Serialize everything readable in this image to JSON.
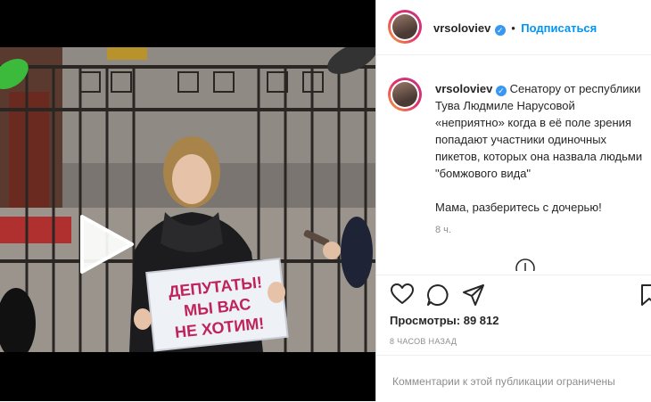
{
  "header": {
    "username": "vrsoloviev",
    "follow_label": "Подписаться",
    "verified_icon": "✓"
  },
  "post": {
    "username": "vrsoloviev",
    "caption_line1": "Сенатору от республики Тува Людмиле Нарусовой «неприятно» когда в её поле зрения попадают участники одиночных пикетов, которых она назвала людьми \"бомжового вида\"",
    "caption_line2": "Мама, разберитесь с дочерью!",
    "time": "8 ч."
  },
  "stats": {
    "views_label": "Просмотры:",
    "views_value": "89 812",
    "age": "8 ЧАСОВ НАЗАД"
  },
  "comments": {
    "notice": "Комментарии к этой публикации ограничены"
  },
  "video": {
    "sign_line1": "ДЕПУТАТЫ!",
    "sign_line2": "МЫ ВАС",
    "sign_line3": "НЕ ХОТИМ!"
  },
  "colors": {
    "accent": "#0095f6",
    "verified": "#3897f0",
    "sign_text": "#c0235a"
  },
  "icons": [
    "play-icon",
    "heart-icon",
    "comment-icon",
    "share-icon",
    "bookmark-icon",
    "more-options-icon"
  ]
}
